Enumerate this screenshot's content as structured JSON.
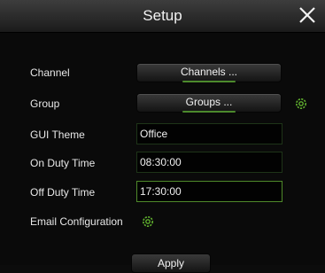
{
  "window": {
    "title": "Setup"
  },
  "fields": {
    "channel": {
      "label": "Channel",
      "button": "Channels ..."
    },
    "group": {
      "label": "Group",
      "button": "Groups ..."
    },
    "gui_theme": {
      "label": "GUI Theme",
      "value": "Office"
    },
    "on_duty_time": {
      "label": "On Duty Time",
      "value": "08:30:00"
    },
    "off_duty_time": {
      "label": "Off Duty Time",
      "value": "17:30:00"
    },
    "email_configuration": {
      "label": "Email Configuration"
    }
  },
  "actions": {
    "apply": "Apply"
  },
  "icons": {
    "close": "close-icon",
    "settings": "gear-icon"
  },
  "colors": {
    "accent": "#4f8a2a",
    "background": "#0a0a0a"
  }
}
